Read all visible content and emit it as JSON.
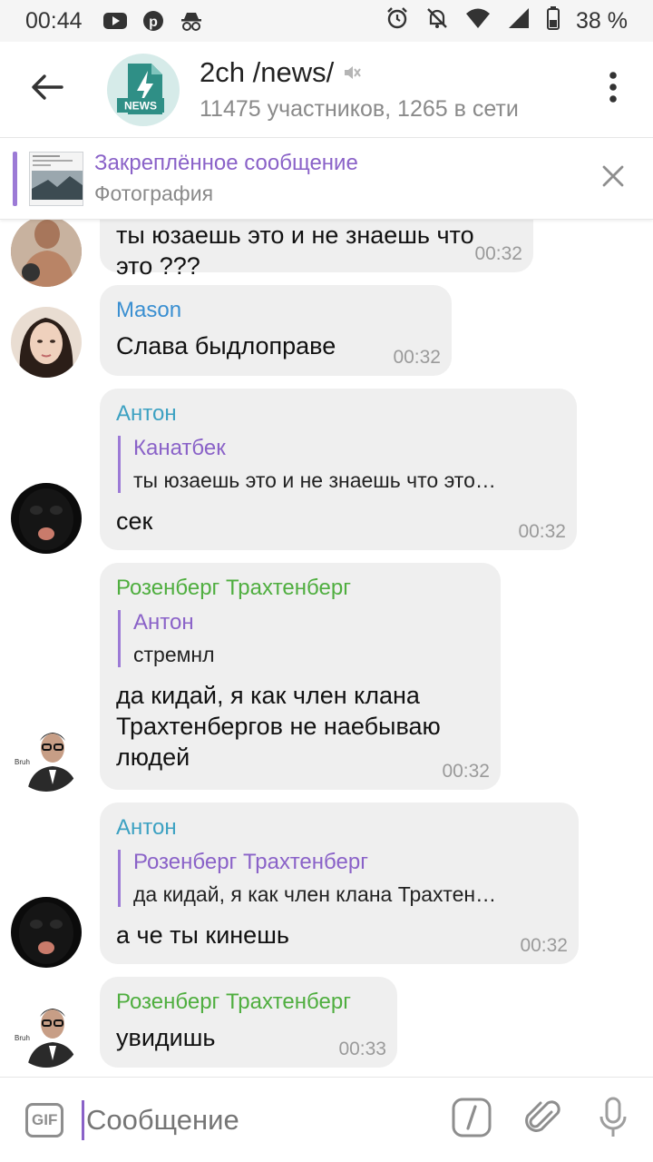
{
  "status_bar": {
    "time": "00:44",
    "battery": "38 %"
  },
  "header": {
    "title": "2ch /news/",
    "subtitle": "11475 участников, 1265 в сети",
    "avatar_label": "NEWS"
  },
  "pinned": {
    "title": "Закреплённое сообщение",
    "subtitle": "Фотография"
  },
  "messages": [
    {
      "text": "ты юзаешь это и не знаешь что это ???",
      "time": "00:32"
    },
    {
      "sender": "Mason",
      "sender_color": "#3a8fd1",
      "text": "Слава быдлоправе",
      "time": "00:32"
    },
    {
      "sender": "Антон",
      "sender_color": "#3ca1c2",
      "reply_name": "Канатбек",
      "reply_text": "ты юзаешь это и не знаешь что это…",
      "text": "сек",
      "time": "00:32"
    },
    {
      "sender": "Розенберг Трахтенберг",
      "sender_color": "#4fae3f",
      "reply_name": "Антон",
      "reply_text": "стремнл",
      "text": "да кидай, я как член клана Трахтенбергов не наебываю людей",
      "time": "00:32"
    },
    {
      "sender": "Антон",
      "sender_color": "#3ca1c2",
      "reply_name": "Розенберг Трахтенберг",
      "reply_text": "да кидай, я как член клана Трахтен…",
      "text": "а че ты кинешь",
      "time": "00:32"
    },
    {
      "sender": "Розенберг Трахтенберг",
      "sender_color": "#4fae3f",
      "text": "увидишь",
      "time": "00:33"
    }
  ],
  "avatar_caption": "Bruh",
  "input": {
    "placeholder": "Сообщение",
    "gif_label": "GIF"
  },
  "icons": {
    "back": "arrow-left-icon",
    "muted": "muted-speaker-icon",
    "menu": "more-vertical-icon",
    "close": "close-icon",
    "commands": "slash-command-icon",
    "attach": "paperclip-icon",
    "mic": "microphone-icon"
  },
  "colors": {
    "accent": "#8a62c8",
    "bubble": "#efefef"
  }
}
